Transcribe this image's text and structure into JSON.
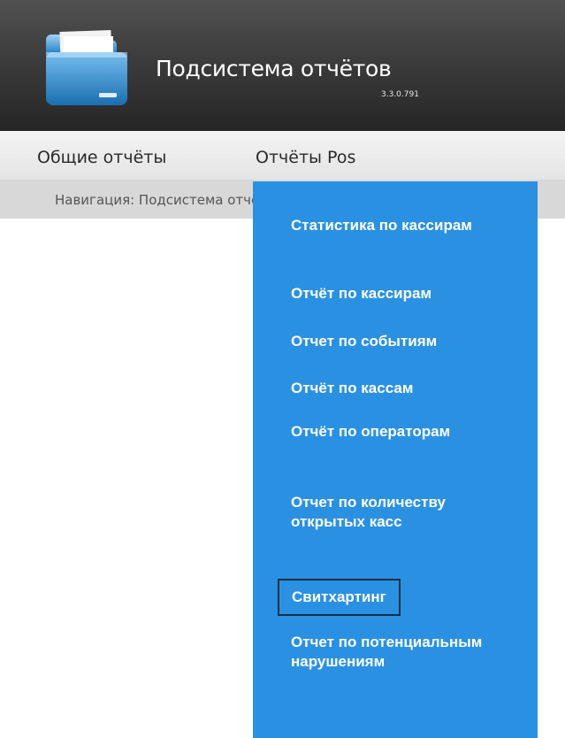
{
  "app": {
    "title": "Подсистема отчётов",
    "version": "3.3.0.791"
  },
  "menu": {
    "items": [
      {
        "label": "Общие отчёты"
      },
      {
        "label": "Отчёты Pos"
      }
    ]
  },
  "breadcrumb": {
    "text": "Навигация: Подсистема отчётов"
  },
  "dropdown": {
    "items": [
      {
        "label": "Статистика по кассирам"
      },
      {
        "label": "Отчёт по кассирам"
      },
      {
        "label": "Отчет по событиям"
      },
      {
        "label": "Отчёт по кассам"
      },
      {
        "label": "Отчёт по операторам"
      },
      {
        "label": "Отчет по количеству открытых касс"
      },
      {
        "label": "Свитхартинг"
      },
      {
        "label": "Отчет по потенциальным нарушениям"
      }
    ],
    "focused_index": 6
  },
  "colors": {
    "header_bg": "#3c3c3c",
    "menubar_bg": "#eeeeee",
    "breadcrumb_bg": "#d8d8d8",
    "dropdown_bg": "#2a91e2",
    "focus_border": "#123047"
  },
  "icons": {
    "logo": "folder-icon"
  }
}
